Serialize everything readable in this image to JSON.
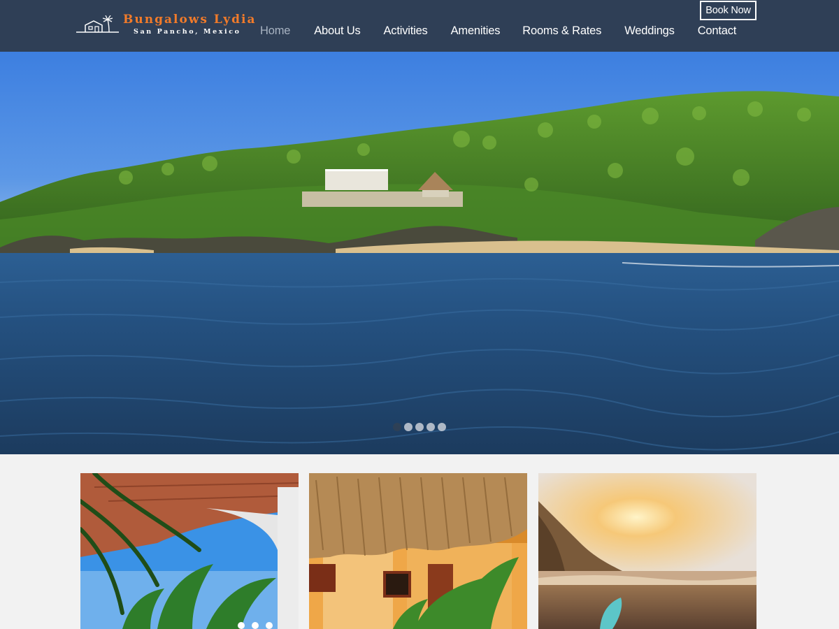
{
  "brand": {
    "name": "Bungalows Lydia",
    "location": "San Pancho, Mexico",
    "accent_color": "#f27b2a",
    "header_color": "#2f3f56"
  },
  "nav": {
    "items": [
      {
        "label": "Home",
        "active": true
      },
      {
        "label": "About Us",
        "active": false
      },
      {
        "label": "Activities",
        "active": false
      },
      {
        "label": "Amenities",
        "active": false
      },
      {
        "label": "Rooms & Rates",
        "active": false
      },
      {
        "label": "Weddings",
        "active": false
      },
      {
        "label": "Contact",
        "active": false
      }
    ],
    "book_label": "Book Now"
  },
  "hero": {
    "slide_count": 5,
    "active_slide": 1,
    "image": "tropical coastline with palm-covered hillside, villa and ocean"
  },
  "cards": [
    {
      "image": "terrace-palm-view"
    },
    {
      "image": "thatched-bungalow"
    },
    {
      "image": "sunset-beach-surfboard"
    }
  ]
}
